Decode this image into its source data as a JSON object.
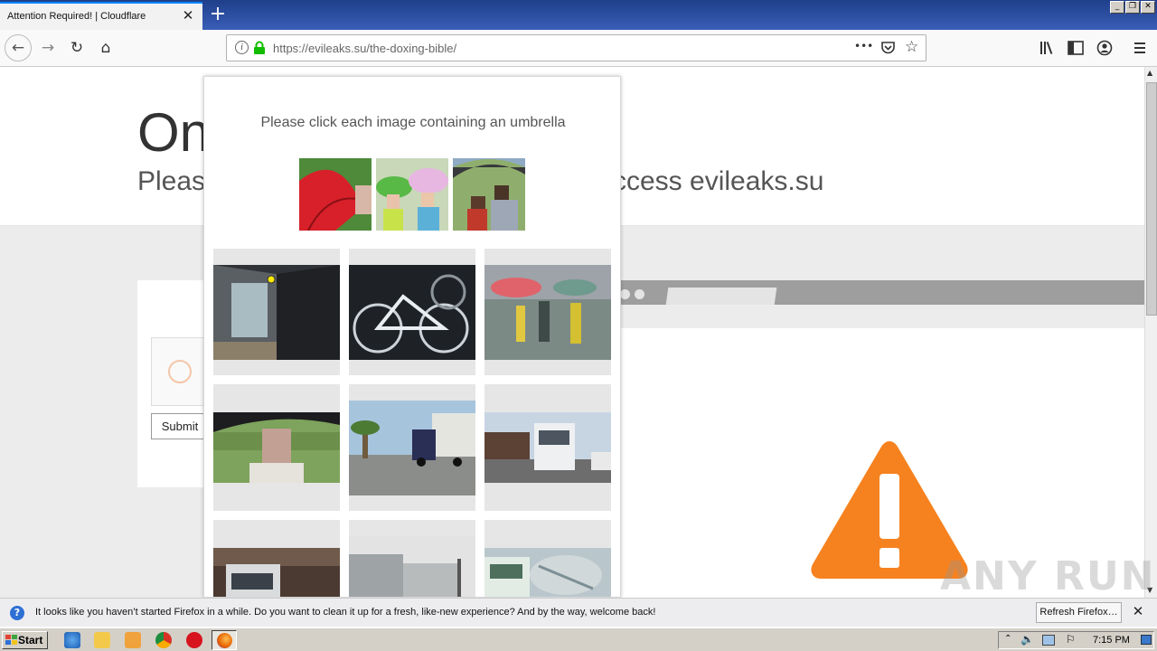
{
  "browser": {
    "tab_title": "Attention Required! | Cloudflare",
    "tab_close": "✕",
    "new_tab": "+",
    "url_domain": "https://evileaks.su",
    "url_path": "/the-doxing-bible/",
    "more": "•••"
  },
  "page": {
    "heading": "On",
    "subheading": "Pleas",
    "subheading_tail": "ccess evileaks.su",
    "submit_label": "Submit"
  },
  "captcha": {
    "prompt": "Please click each image containing an umbrella"
  },
  "notification": {
    "message": "It looks like you haven’t started Firefox in a while. Do you want to clean it up for a fresh, like-new experience? And by the way, welcome back!",
    "refresh_label": "Refresh Firefox…",
    "close": "✕"
  },
  "taskbar": {
    "start_label": "Start",
    "clock": "7:15 PM"
  },
  "watermark": "ANY RUN",
  "colors": {
    "warning_orange": "#f6821f",
    "accent_blue": "#0a84ff",
    "secure_green": "#12bc00"
  }
}
